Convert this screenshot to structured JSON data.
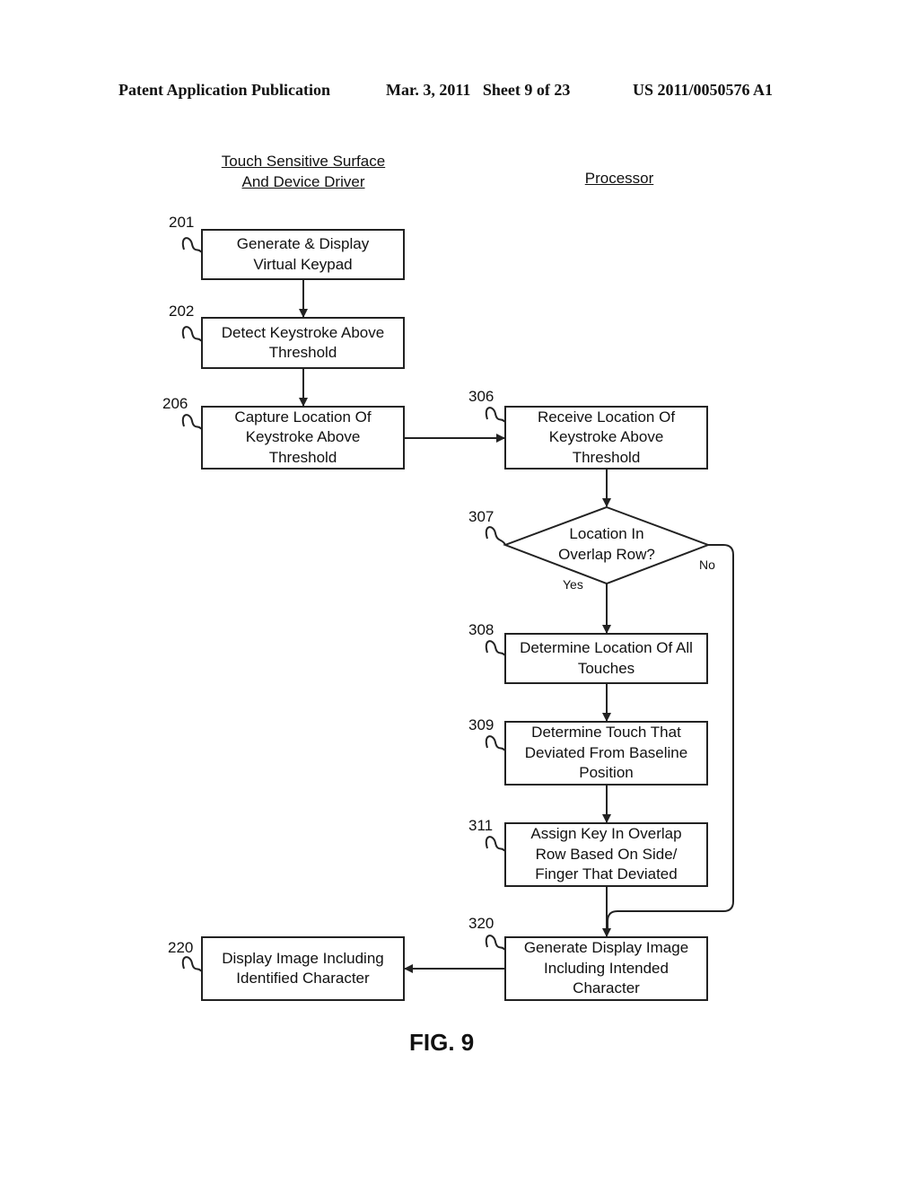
{
  "header": {
    "publication": "Patent Application Publication",
    "date_sheet": "Mar. 3, 2011   Sheet 9 of 23",
    "number": "US 2011/0050576 A1"
  },
  "columns": {
    "left_title_line1": "Touch Sensitive Surface",
    "left_title_line2": "And Device Driver",
    "right_title": "Processor"
  },
  "nodes": {
    "n201": {
      "ref": "201",
      "line1": "Generate & Display",
      "line2": "Virtual Keypad"
    },
    "n202": {
      "ref": "202",
      "line1": "Detect Keystroke Above",
      "line2": "Threshold"
    },
    "n206": {
      "ref": "206",
      "line1": "Capture Location Of",
      "line2": "Keystroke Above",
      "line3": "Threshold"
    },
    "n306": {
      "ref": "306",
      "line1": "Receive Location Of",
      "line2": "Keystroke Above",
      "line3": "Threshold"
    },
    "n307": {
      "ref": "307",
      "line1": "Location In",
      "line2": "Overlap Row?",
      "yes": "Yes",
      "no": "No"
    },
    "n308": {
      "ref": "308",
      "line1": "Determine Location Of All",
      "line2": "Touches"
    },
    "n309": {
      "ref": "309",
      "line1": "Determine Touch That",
      "line2": "Deviated From Baseline",
      "line3": "Position"
    },
    "n311": {
      "ref": "311",
      "line1": "Assign Key In Overlap",
      "line2": "Row Based On Side/",
      "line3": "Finger That Deviated"
    },
    "n320": {
      "ref": "320",
      "line1": "Generate Display Image",
      "line2": "Including Intended",
      "line3": "Character"
    },
    "n220": {
      "ref": "220",
      "line1": "Display Image Including",
      "line2": "Identified Character"
    }
  },
  "figure_label": "FIG. 9"
}
